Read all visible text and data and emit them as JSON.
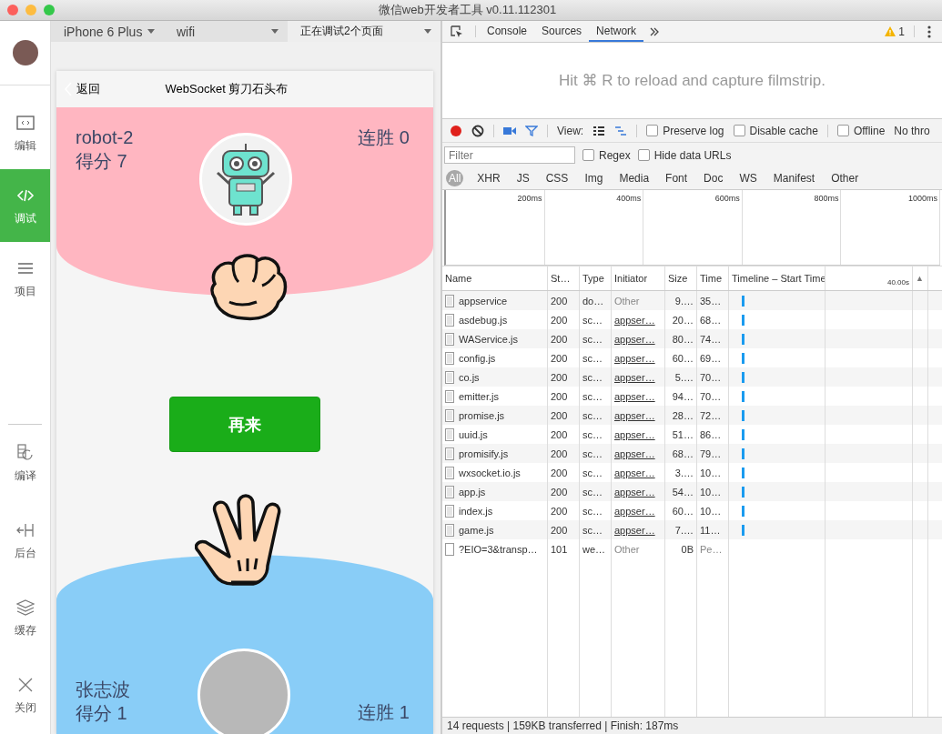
{
  "window": {
    "title": "微信web开发者工具 v0.11.112301"
  },
  "sidebar": {
    "items": [
      {
        "label": "编辑",
        "selected": false
      },
      {
        "label": "调试",
        "selected": true
      },
      {
        "label": "项目",
        "selected": false
      }
    ],
    "tools": [
      {
        "label": "编译"
      },
      {
        "label": "后台"
      },
      {
        "label": "缓存"
      },
      {
        "label": "关闭"
      }
    ]
  },
  "simulator": {
    "device": "iPhone 6 Plus",
    "network": "wifi",
    "pages": "正在调试2个页面",
    "nav": {
      "back": "返回",
      "title": "WebSocket 剪刀石头布"
    },
    "opponent": {
      "name": "robot-2",
      "score": "得分 7",
      "streak": "连胜 0"
    },
    "button": "再来",
    "player": {
      "name": "张志波",
      "score": "得分 1",
      "streak": "连胜 1"
    }
  },
  "devtools": {
    "tabs": [
      {
        "label": "Console",
        "selected": false
      },
      {
        "label": "Sources",
        "selected": false
      },
      {
        "label": "Network",
        "selected": true
      }
    ],
    "warning_count": "1",
    "filmstrip_hint": "Hit ⌘ R to reload and capture filmstrip.",
    "recording": true,
    "view_label": "View:",
    "options": [
      {
        "label": "Preserve log",
        "checked": false
      },
      {
        "label": "Disable cache",
        "checked": false
      },
      {
        "label": "Offline",
        "checked": false
      }
    ],
    "throttle": "No thro",
    "filter": {
      "placeholder": "Filter"
    },
    "filter_options": [
      {
        "label": "Regex",
        "checked": false
      },
      {
        "label": "Hide data URLs",
        "checked": false
      }
    ],
    "types": [
      {
        "label": "All",
        "selected": true
      },
      {
        "label": "XHR",
        "selected": false
      },
      {
        "label": "JS",
        "selected": false
      },
      {
        "label": "CSS",
        "selected": false
      },
      {
        "label": "Img",
        "selected": false
      },
      {
        "label": "Media",
        "selected": false
      },
      {
        "label": "Font",
        "selected": false
      },
      {
        "label": "Doc",
        "selected": false
      },
      {
        "label": "WS",
        "selected": false
      },
      {
        "label": "Manifest",
        "selected": false
      },
      {
        "label": "Other",
        "selected": false
      }
    ],
    "overview_ticks": [
      "200ms",
      "400ms",
      "600ms",
      "800ms",
      "1000ms"
    ],
    "columns": [
      "Name",
      "St…",
      "Type",
      "Initiator",
      "Size",
      "Time",
      "Timeline – Start Time",
      "40.00s",
      "▲"
    ],
    "rows": [
      {
        "name": "appservice",
        "status": "200",
        "type": "do…",
        "initiator": "Other",
        "linked": false,
        "size": "9.…",
        "time": "35…",
        "pending": false
      },
      {
        "name": "asdebug.js",
        "status": "200",
        "type": "sc…",
        "initiator": "appser…",
        "linked": true,
        "size": "20…",
        "time": "68…",
        "pending": false
      },
      {
        "name": "WAService.js",
        "status": "200",
        "type": "sc…",
        "initiator": "appser…",
        "linked": true,
        "size": "80…",
        "time": "74…",
        "pending": false
      },
      {
        "name": "config.js",
        "status": "200",
        "type": "sc…",
        "initiator": "appser…",
        "linked": true,
        "size": "60…",
        "time": "69…",
        "pending": false
      },
      {
        "name": "co.js",
        "status": "200",
        "type": "sc…",
        "initiator": "appser…",
        "linked": true,
        "size": "5.…",
        "time": "70…",
        "pending": false
      },
      {
        "name": "emitter.js",
        "status": "200",
        "type": "sc…",
        "initiator": "appser…",
        "linked": true,
        "size": "94…",
        "time": "70…",
        "pending": false
      },
      {
        "name": "promise.js",
        "status": "200",
        "type": "sc…",
        "initiator": "appser…",
        "linked": true,
        "size": "28…",
        "time": "72…",
        "pending": false
      },
      {
        "name": "uuid.js",
        "status": "200",
        "type": "sc…",
        "initiator": "appser…",
        "linked": true,
        "size": "51…",
        "time": "86…",
        "pending": false
      },
      {
        "name": "promisify.js",
        "status": "200",
        "type": "sc…",
        "initiator": "appser…",
        "linked": true,
        "size": "68…",
        "time": "79…",
        "pending": false
      },
      {
        "name": "wxsocket.io.js",
        "status": "200",
        "type": "sc…",
        "initiator": "appser…",
        "linked": true,
        "size": "3.…",
        "time": "10…",
        "pending": false
      },
      {
        "name": "app.js",
        "status": "200",
        "type": "sc…",
        "initiator": "appser…",
        "linked": true,
        "size": "54…",
        "time": "10…",
        "pending": false
      },
      {
        "name": "index.js",
        "status": "200",
        "type": "sc…",
        "initiator": "appser…",
        "linked": true,
        "size": "60…",
        "time": "10…",
        "pending": false
      },
      {
        "name": "game.js",
        "status": "200",
        "type": "sc…",
        "initiator": "appser…",
        "linked": true,
        "size": "7.…",
        "time": "11…",
        "pending": false
      },
      {
        "name": "?EIO=3&transp…",
        "status": "101",
        "type": "we…",
        "initiator": "Other",
        "linked": false,
        "size": "0B",
        "time": "Pe…",
        "pending": true
      }
    ],
    "status_bar": "14 requests | 159KB transferred | Finish: 187ms"
  }
}
